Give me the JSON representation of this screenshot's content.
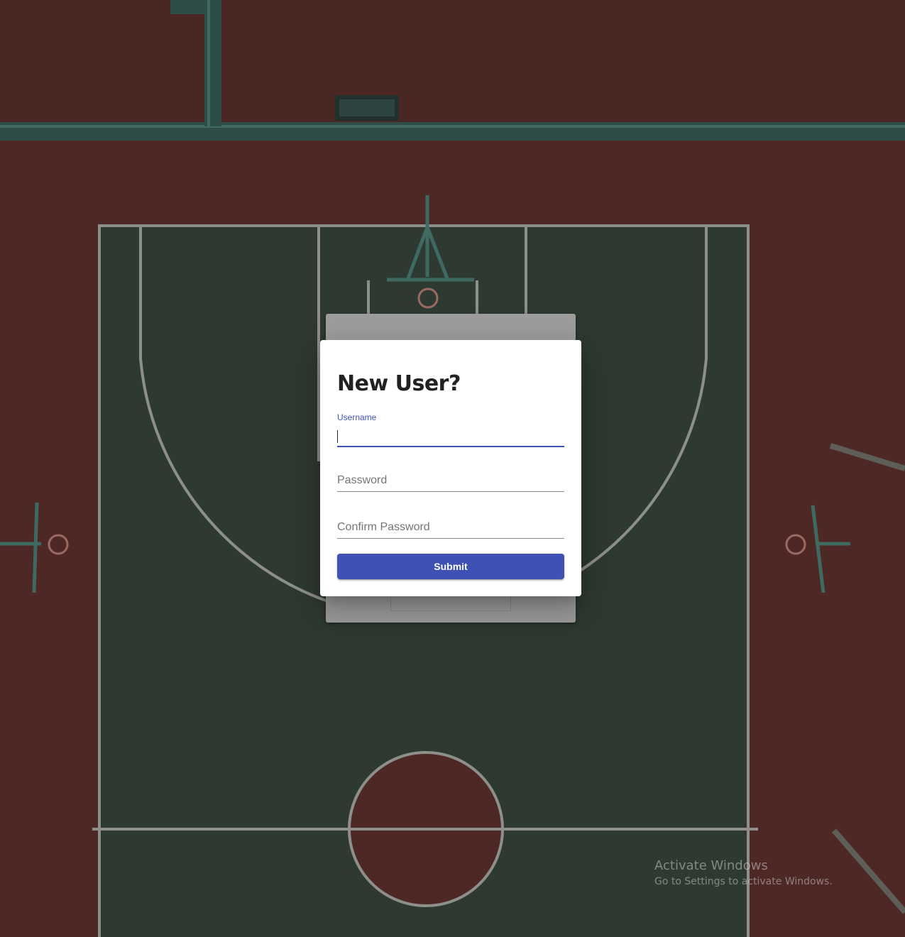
{
  "colors": {
    "primary": "#3f51b5",
    "dialog_bg": "#ffffff",
    "court_red": "#5a2b26",
    "court_green": "#2f3d33"
  },
  "dialog": {
    "title": "New User?",
    "fields": {
      "username": {
        "label": "Username",
        "value": ""
      },
      "password": {
        "placeholder": "Password",
        "value": ""
      },
      "confirm_password": {
        "placeholder": "Confirm Password",
        "value": ""
      }
    },
    "submit_label": "Submit"
  },
  "watermark": {
    "title": "Activate Windows",
    "subtitle": "Go to Settings to activate Windows."
  }
}
